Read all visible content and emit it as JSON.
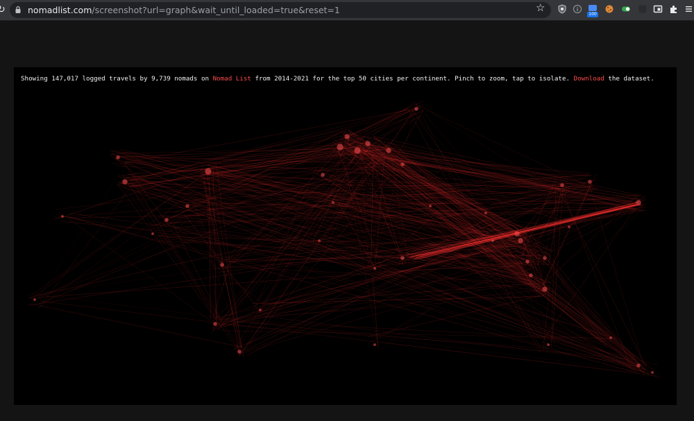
{
  "browser": {
    "url_host": "nomadlist.com",
    "url_path": "/screenshot?url=graph&wait_until_loaded=true&reset=1",
    "extension_badge": "100",
    "icons": [
      "reload-icon",
      "lock-icon",
      "star-icon",
      "shield-extension-icon",
      "info-extension-icon",
      "blue-extension-icon",
      "cookie-extension-icon",
      "green-toggle-extension-icon",
      "dark-extension-icon",
      "window-extension-icon",
      "puzzle-icon",
      "menu-icon"
    ]
  },
  "caption": {
    "part1": "Showing 147,017 logged travels by 9,739 nomads on ",
    "link1": "Nomad List",
    "part2": " from 2014-2021 for the top 50 cities per continent. Pinch to zoom, tap to isolate. ",
    "link2": "Download",
    "part3": " the dataset."
  },
  "colors": {
    "page_bg": "#141414",
    "viz_bg": "#000000",
    "link": "#ff4b4b",
    "travel_line": "#ff3030"
  }
}
